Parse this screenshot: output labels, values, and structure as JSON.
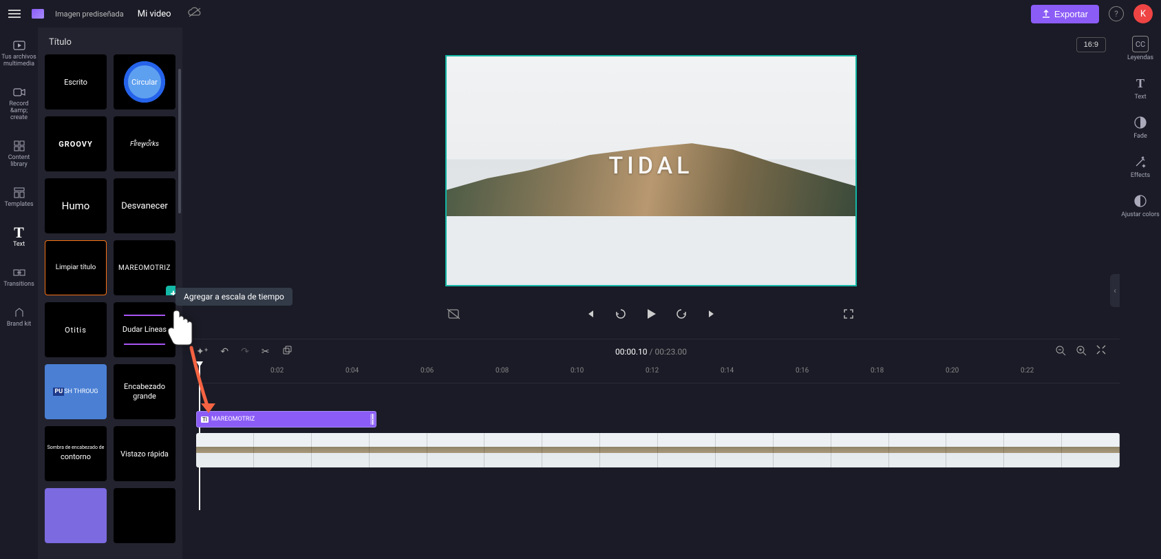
{
  "header": {
    "breadcrumb_a": "Imagen prediseñada",
    "breadcrumb_b": "Mi video",
    "export_label": "Exportar",
    "avatar_letter": "K"
  },
  "left_rail": [
    {
      "label": "Tus archivos multimedia",
      "icon": "▢"
    },
    {
      "label": "Record &amp; create",
      "icon": "◉"
    },
    {
      "label": "Content library",
      "icon": "⊞"
    },
    {
      "label": "Templates",
      "icon": "▦"
    },
    {
      "label": "Text",
      "icon": "T"
    },
    {
      "label": "Transitions",
      "icon": "⇆"
    },
    {
      "label": "Brand kit",
      "icon": "⬠"
    }
  ],
  "panel": {
    "title": "Título",
    "thumbs": {
      "escrito": "Escrito",
      "circular": "Circular",
      "groovy": "GROOVY",
      "fireworks": "Fireworks",
      "humo": "Humo",
      "desvanecer": "Desvanecer",
      "limpiar": "Limpiar título",
      "mareomotriz": "MAREOMOTRIZ",
      "otitis": "Otitis",
      "dudar": "Dudar Líneas",
      "push": "SH THROUG",
      "push_prefix": "PU",
      "encabezado": "Encabezado grande",
      "sombra_line1": "Sombra de encabezado de",
      "sombra_line2": "contorno",
      "vistazo": "Vistazo rápida"
    },
    "tooltip_add": "Agregar a escala de tiempo"
  },
  "preview": {
    "aspect": "16:9",
    "overlay_text": "TIDAL"
  },
  "timeline": {
    "current_time": "00:00.10",
    "total_time": "00:23.00",
    "ticks": [
      "0:02",
      "0:04",
      "0:06",
      "0:08",
      "0:10",
      "0:12",
      "0:14",
      "0:16",
      "0:18",
      "0:20",
      "0:22"
    ],
    "text_clip_label": "MAREOMOTRIZ",
    "text_clip_prefix": "TI"
  },
  "right_rail": [
    {
      "label": "Leyendas",
      "icon": "CC"
    },
    {
      "label": "Text",
      "icon": "T"
    },
    {
      "label": "Fade",
      "icon": "◐"
    },
    {
      "label": "Effects",
      "icon": "✧"
    },
    {
      "label": "Ajustar colors",
      "icon": "◑"
    }
  ]
}
